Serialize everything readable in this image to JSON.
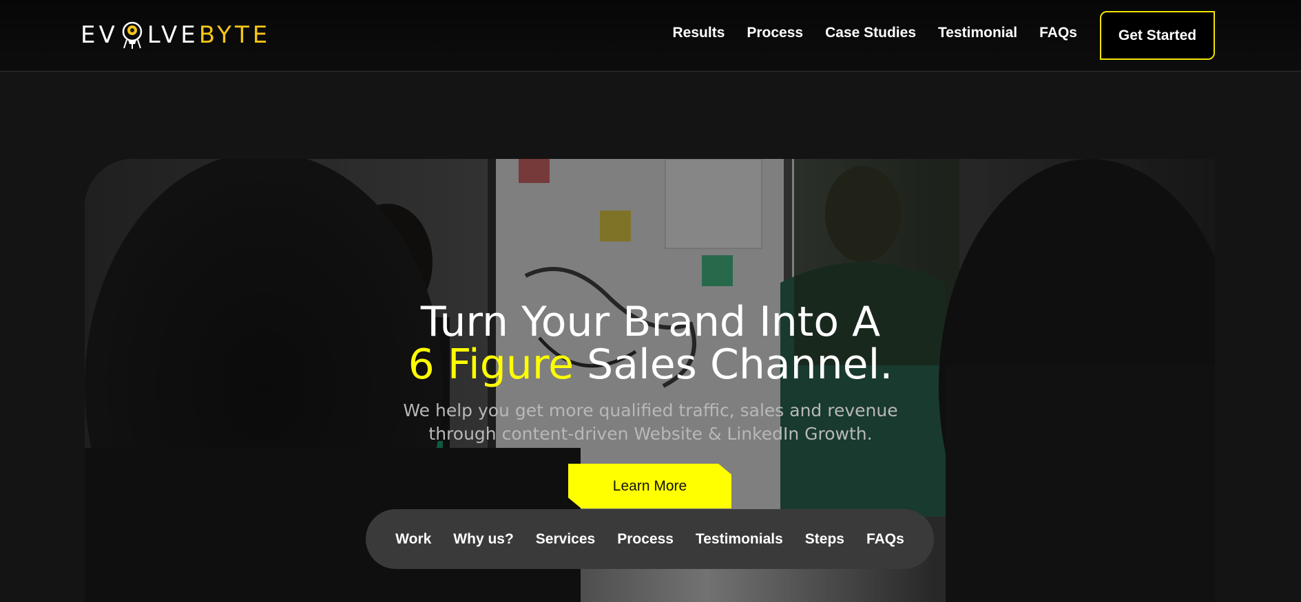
{
  "brand": {
    "logo_left": "EV",
    "logo_mid": "LVE",
    "logo_right": "BYTE",
    "accent_color": "#ffff00",
    "logo_accent_color": "#f5c518"
  },
  "header": {
    "nav": [
      "Results",
      "Process",
      "Case Studies",
      "Testimonial",
      "FAQs"
    ],
    "cta_label": "Get Started"
  },
  "hero": {
    "headline_line1": "Turn Your Brand Into A",
    "headline_highlight": "6 Figure",
    "headline_rest": "Sales Channel.",
    "subtext_line1": "We help you get more qualified traffic, sales and revenue",
    "subtext_line2": "through content-driven Website & LinkedIn Growth.",
    "button_label": "Learn More"
  },
  "section_nav": [
    "Work",
    "Why us?",
    "Services",
    "Process",
    "Testimonials",
    "Steps",
    "FAQs"
  ]
}
